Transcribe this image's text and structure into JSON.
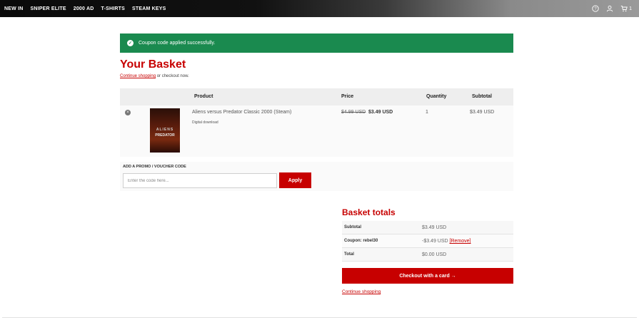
{
  "nav": {
    "items": [
      "NEW IN",
      "SNIPER ELITE",
      "2000 AD",
      "T-SHIRTS",
      "STEAM KEYS"
    ],
    "help_icon": "help-circle-icon",
    "account_icon": "user-icon",
    "cart_icon": "cart-icon",
    "cart_count": "1"
  },
  "alert": {
    "message": "Coupon code applied successfully.",
    "icon": "check-circle-icon",
    "color": "#1a8a4f"
  },
  "basket": {
    "title": "Your Basket",
    "continue_link": "Continue shopping",
    "or_text": " or checkout now."
  },
  "table": {
    "headers": {
      "product": "Product",
      "price": "Price",
      "quantity": "Quantity",
      "subtotal": "Subtotal"
    },
    "items": [
      {
        "name": "Aliens versus Predator Classic 2000 (Steam)",
        "meta": "Digital download",
        "price_old": "$4.99 USD",
        "price_new": "$3.49 USD",
        "quantity": "1",
        "subtotal": "$3.49 USD",
        "image_title_1": "ALIENS",
        "image_title_2": "PREDATOR"
      }
    ]
  },
  "promo": {
    "label": "ADD A PROMO / VOUCHER CODE",
    "placeholder": "Enter the code here...",
    "button": "Apply"
  },
  "totals": {
    "title": "Basket totals",
    "rows": [
      {
        "label": "Subtotal",
        "value": "$3.49 USD"
      },
      {
        "label": "Coupon: rebel30",
        "value": "-$3.49 USD",
        "link": "[Remove]"
      },
      {
        "label": "Total",
        "value": "$0.00 USD"
      }
    ],
    "checkout_button": "Checkout with a card →",
    "continue_link": "Continue shopping"
  },
  "colors": {
    "accent": "#c70000",
    "success": "#1a8a4f"
  }
}
